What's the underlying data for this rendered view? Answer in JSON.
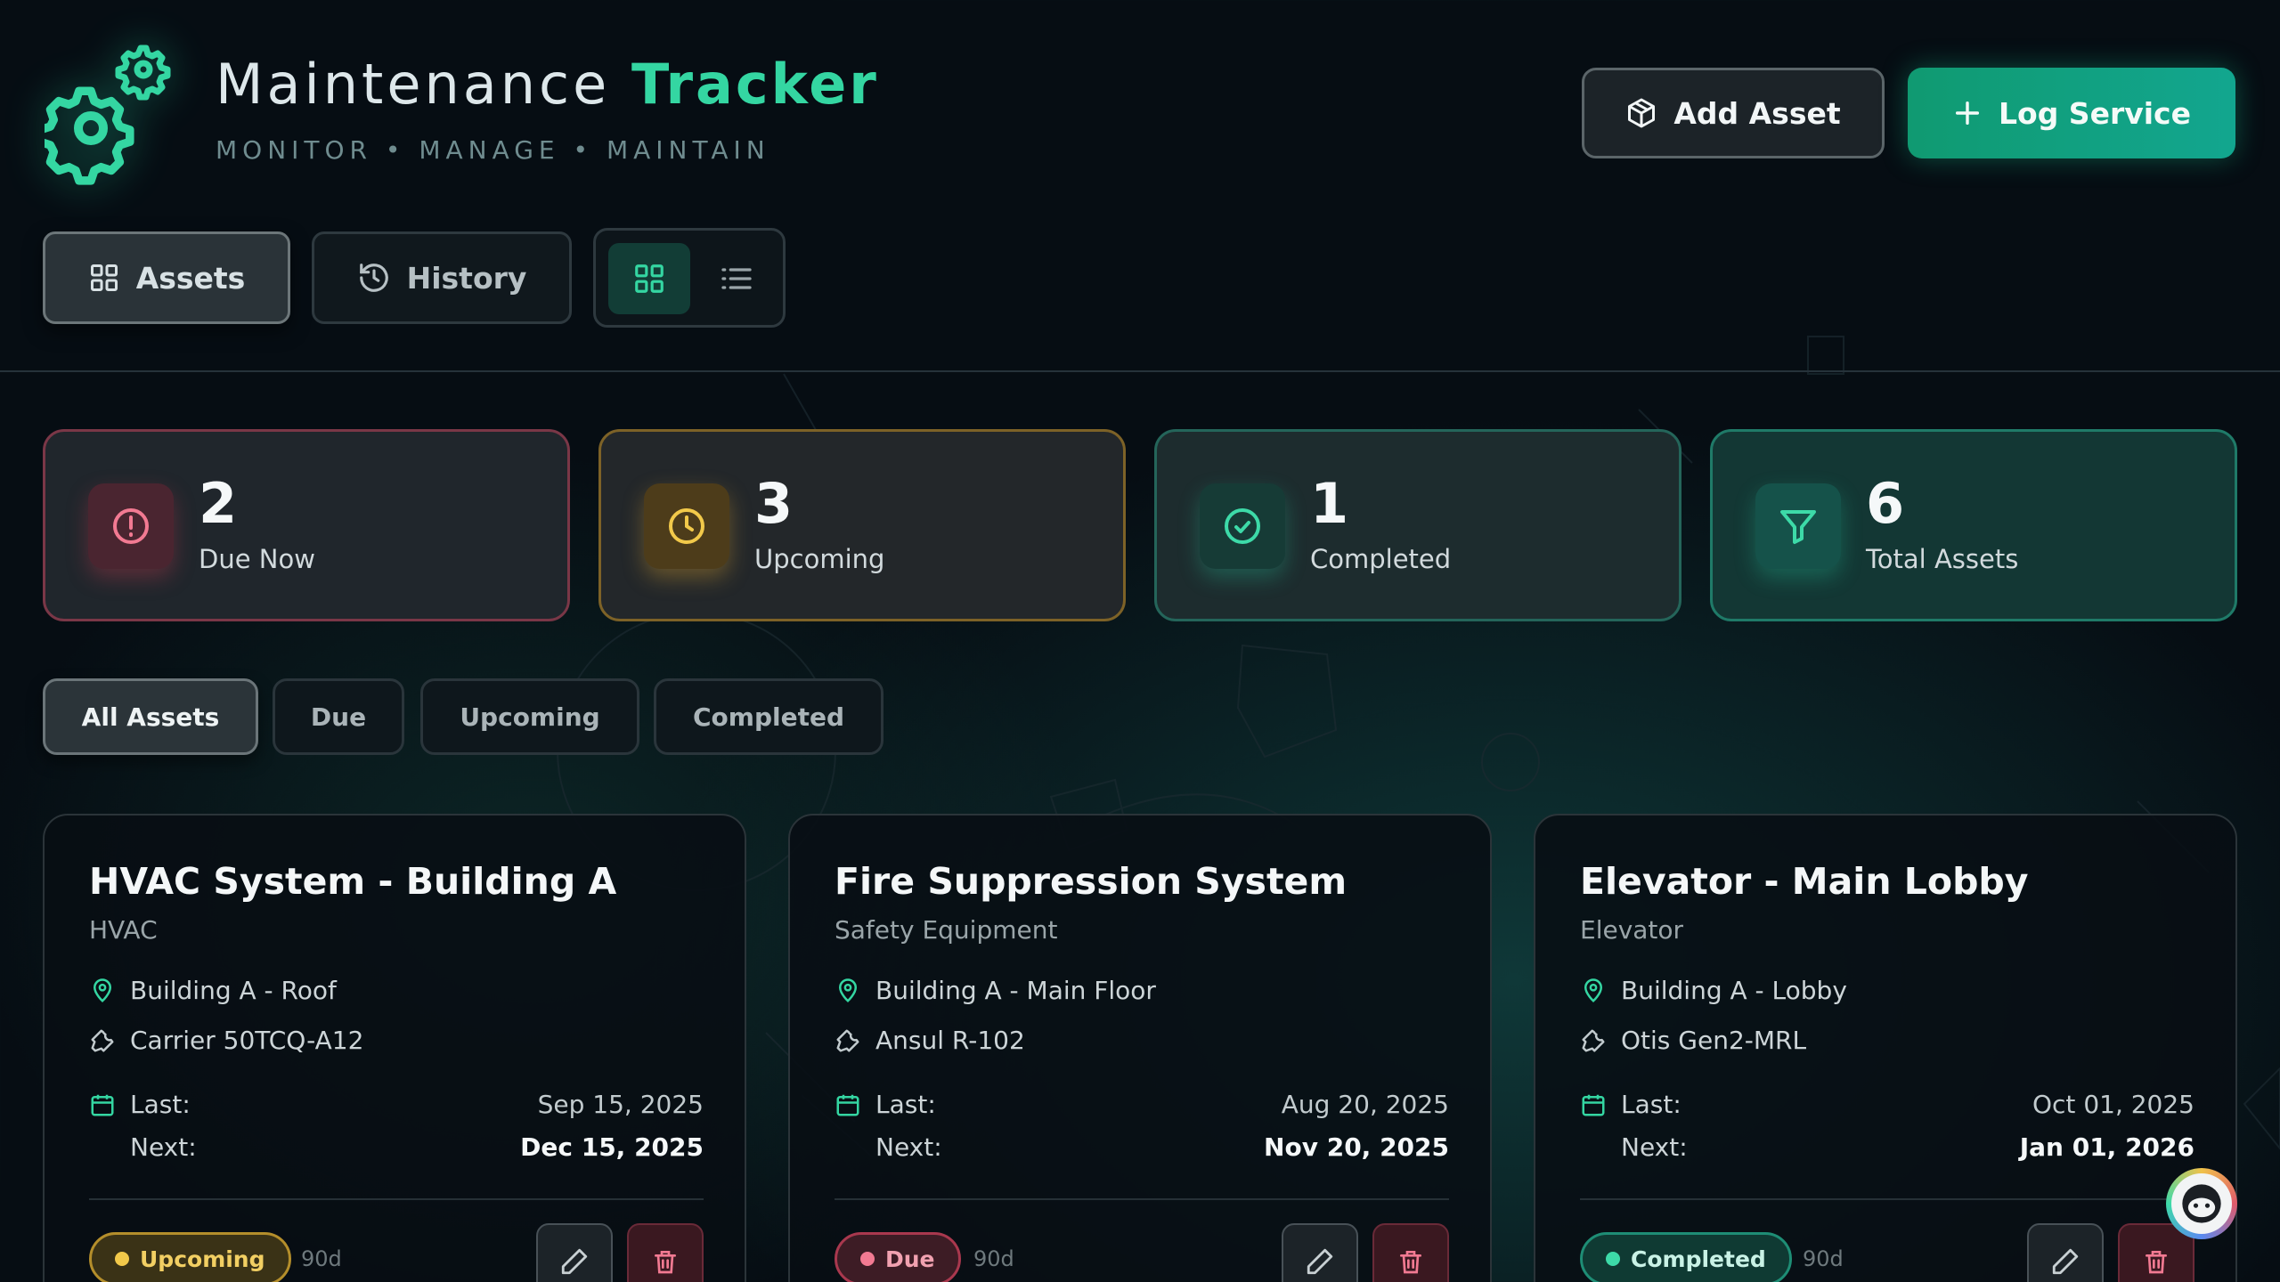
{
  "header": {
    "title_primary": "Maintenance",
    "title_accent": "Tracker",
    "subtitle": "MONITOR • MANAGE • MAINTAIN",
    "add_asset_label": "Add Asset",
    "log_service_label": "Log Service"
  },
  "nav": {
    "assets_label": "Assets",
    "history_label": "History"
  },
  "stats": [
    {
      "value": "2",
      "label": "Due Now"
    },
    {
      "value": "3",
      "label": "Upcoming"
    },
    {
      "value": "1",
      "label": "Completed"
    },
    {
      "value": "6",
      "label": "Total Assets"
    }
  ],
  "filters": [
    "All Assets",
    "Due",
    "Upcoming",
    "Completed"
  ],
  "cards": [
    {
      "title": "HVAC System - Building A",
      "category": "HVAC",
      "location": "Building A - Roof",
      "model": "Carrier 50TCQ-A12",
      "last_label": "Last:",
      "last_date": "Sep 15, 2025",
      "next_label": "Next:",
      "next_date": "Dec 15, 2025",
      "status": "Upcoming",
      "interval": "90d"
    },
    {
      "title": "Fire Suppression System",
      "category": "Safety Equipment",
      "location": "Building A - Main Floor",
      "model": "Ansul R-102",
      "last_label": "Last:",
      "last_date": "Aug 20, 2025",
      "next_label": "Next:",
      "next_date": "Nov 20, 2025",
      "status": "Due",
      "interval": "90d"
    },
    {
      "title": "Elevator - Main Lobby",
      "category": "Elevator",
      "location": "Building A - Lobby",
      "model": "Otis Gen2-MRL",
      "last_label": "Last:",
      "last_date": "Oct 01, 2025",
      "next_label": "Next:",
      "next_date": "Jan 01, 2026",
      "status": "Completed",
      "interval": "90d"
    }
  ],
  "colors": {
    "accent": "#34d6a2",
    "due": "#f27a92",
    "upcoming": "#f2c94a",
    "completed": "#3ddaa8",
    "background": "#060d13"
  },
  "icons": {
    "logo": "gears-icon",
    "add_asset": "package-icon",
    "log_service": "plus-icon",
    "assets": "grid-icon",
    "history": "history-icon",
    "view_grid": "grid-view-icon",
    "view_list": "list-view-icon",
    "due": "alert-circle-icon",
    "upcoming": "clock-icon",
    "completed": "check-circle-icon",
    "total": "filter-icon",
    "location": "map-pin-icon",
    "model": "wrench-icon",
    "date": "calendar-icon",
    "edit": "pencil-icon",
    "delete": "trash-icon"
  }
}
